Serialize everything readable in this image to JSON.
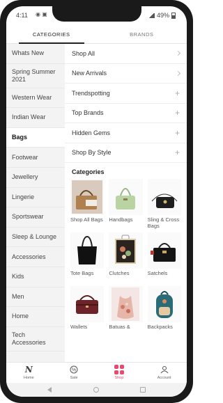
{
  "status": {
    "time": "4:11",
    "left_icons": "◉ ▣",
    "battery": "49%"
  },
  "tabs": [
    {
      "label": "CATEGORIES"
    },
    {
      "label": "BRANDS"
    }
  ],
  "sidebar": {
    "items": [
      {
        "label": "Whats New"
      },
      {
        "label": "Spring Summer 2021"
      },
      {
        "label": "Western Wear"
      },
      {
        "label": "Indian Wear"
      },
      {
        "label": "Bags"
      },
      {
        "label": "Footwear"
      },
      {
        "label": "Jewellery"
      },
      {
        "label": "Lingerie"
      },
      {
        "label": "Sportswear"
      },
      {
        "label": "Sleep & Lounge"
      },
      {
        "label": "Accessories"
      },
      {
        "label": "Kids"
      },
      {
        "label": "Men"
      },
      {
        "label": "Home"
      },
      {
        "label": "Tech Accessories"
      }
    ],
    "active": "Bags"
  },
  "menu": {
    "rows": [
      {
        "label": "Shop All",
        "icon": "chevron-right-icon"
      },
      {
        "label": "New Arrivals",
        "icon": "chevron-right-icon"
      },
      {
        "label": "Trendspotting",
        "icon": "plus-icon"
      },
      {
        "label": "Top Brands",
        "icon": "plus-icon"
      },
      {
        "label": "Hidden Gems",
        "icon": "plus-icon"
      },
      {
        "label": "Shop By Style",
        "icon": "plus-icon"
      }
    ],
    "plus_glyph": "+"
  },
  "categories": {
    "title": "Categories",
    "items": [
      {
        "label": "Shop All Bags",
        "icon": "tan-tote-bag-icon"
      },
      {
        "label": "Handbags",
        "icon": "green-handbag-icon"
      },
      {
        "label": "Sling & Cross Bags",
        "icon": "black-sling-bag-icon"
      },
      {
        "label": "Tote Bags",
        "icon": "black-tote-bag-icon"
      },
      {
        "label": "Clutches",
        "icon": "floral-clutch-icon"
      },
      {
        "label": "Satchels",
        "icon": "black-satchel-icon"
      },
      {
        "label": "Wallets",
        "icon": "maroon-wallet-icon"
      },
      {
        "label": "Batuas &",
        "icon": "floral-batua-icon"
      },
      {
        "label": "Backpacks",
        "icon": "teal-backpack-icon"
      }
    ]
  },
  "bottom_nav": [
    {
      "label": "Home",
      "icon": "brand-logo-icon",
      "glyph": "N"
    },
    {
      "label": "Sale",
      "icon": "sale-tag-icon",
      "glyph": "%"
    },
    {
      "label": "Shop",
      "icon": "shop-grid-icon",
      "glyph": ""
    },
    {
      "label": "Account",
      "icon": "user-icon",
      "glyph": ""
    }
  ],
  "colors": {
    "accent": "#e44b70",
    "sidebar_bg": "#f3f3f3",
    "text": "#222222"
  }
}
